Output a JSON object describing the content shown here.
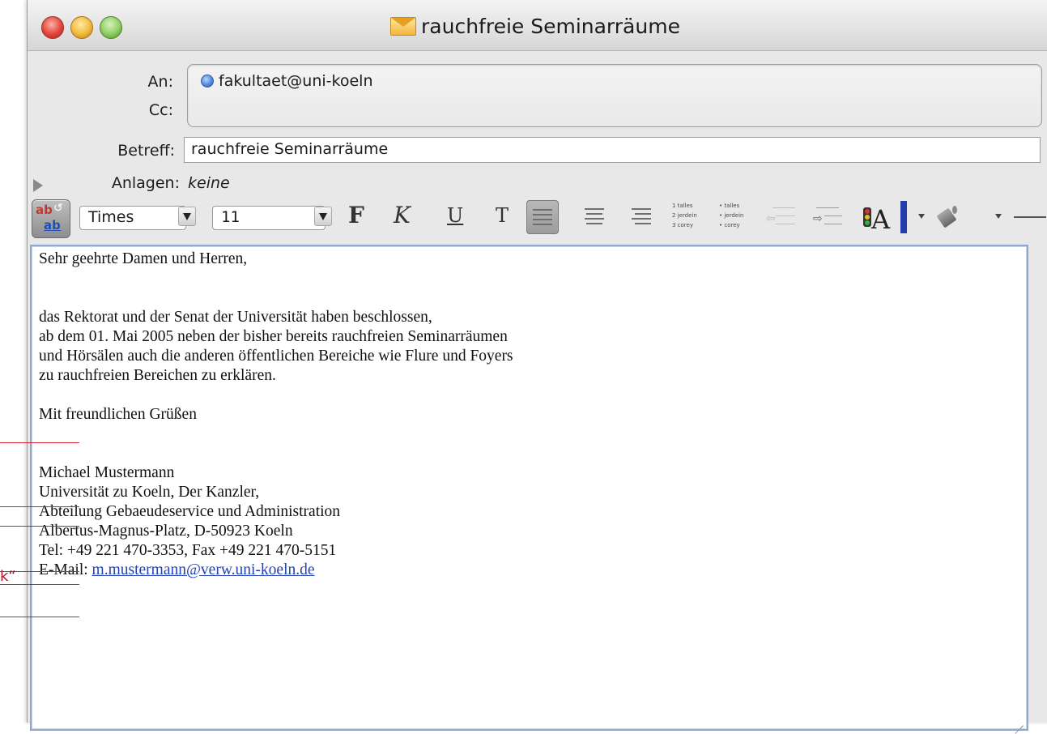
{
  "window": {
    "title": "rauchfreie Seminarräume"
  },
  "header": {
    "to_label": "An:",
    "cc_label": "Cc:",
    "subject_label": "Betreff:",
    "attachments_label": "Anlagen:",
    "to_recipient": "fakultaet@uni-koeln",
    "subject_value": "rauchfreie Seminarräume",
    "attachments_value": "keine"
  },
  "toolbar": {
    "font_name": "Times",
    "font_size": "11",
    "bold_label": "F",
    "italic_label": "K",
    "underline_label": "U",
    "text_style_label": "T",
    "active_alignment": "left",
    "numbered_list_rows": [
      "1 talles",
      "2 jerdein",
      "3 corey"
    ],
    "bullet_list_rows": [
      "• talles",
      "• jerdein",
      "• corey"
    ],
    "text_color": "#233eaa"
  },
  "message": {
    "salutation": "Sehr geehrte Damen und Herren,",
    "paragraph_lines": [
      "das Rektorat und der Senat der Universität haben beschlossen,",
      "ab dem 01. Mai 2005 neben der bisher bereits rauchfreien Seminarräumen",
      "und Hörsälen auch die anderen öffentlichen Bereiche wie Flure und Foyers",
      "zu rauchfreien Bereichen zu erklären."
    ],
    "closing": "Mit freundlichen Grüßen",
    "signature_lines": [
      "Michael Mustermann",
      "Universität zu Koeln, Der Kanzler,",
      "Abteilung Gebaeudeservice und Administration",
      "Albertus-Magnus-Platz, D-50923 Koeln",
      "Tel: +49 221 470-3353, Fax +49 221 470-5151"
    ],
    "email_label": "E-Mail: ",
    "email_link": "m.mustermann@verw.uni-koeln.de"
  },
  "annotation": {
    "quote_mark": "k“"
  }
}
